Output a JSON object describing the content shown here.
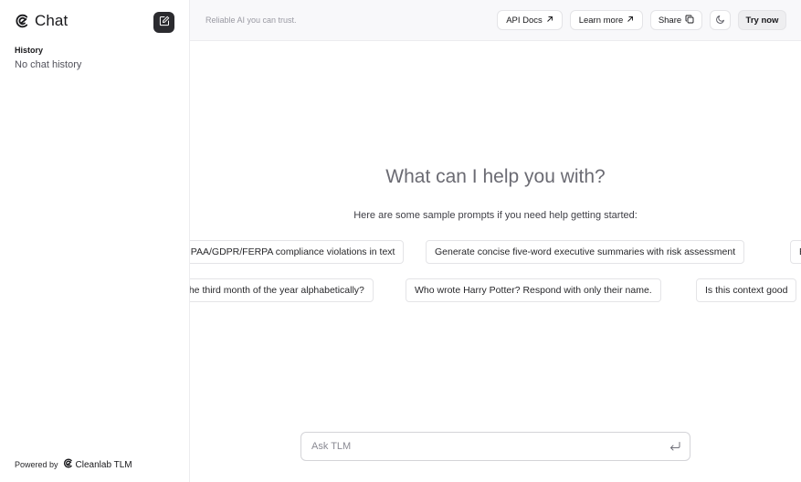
{
  "sidebar": {
    "title": "Chat",
    "history_heading": "History",
    "history_empty": "No chat history",
    "powered_by": "Powered by",
    "powered_brand": "Cleanlab TLM"
  },
  "topbar": {
    "tagline": "Reliable AI you can trust.",
    "api_docs": "API Docs",
    "learn_more": "Learn more",
    "share": "Share",
    "try_now": "Try now"
  },
  "main": {
    "heading": "What can I help you with?",
    "subheading": "Here are some sample prompts if you need help getting started:",
    "prompts_row1": [
      "Detect HIPAA/GDPR/FERPA compliance violations in text",
      "Generate concise five-word executive summaries with risk assessment",
      "E"
    ],
    "prompts_row2": [
      "What is the third month of the year alphabetically?",
      "Who wrote Harry Potter? Respond with only their name.",
      "Is this context good"
    ]
  },
  "composer": {
    "placeholder": "Ask TLM"
  },
  "icons": {
    "logo": "cleanlab-logo-icon",
    "new_chat": "edit-icon",
    "external": "arrow-up-right-icon",
    "share": "copy-icon",
    "theme": "moon-icon",
    "enter": "enter-icon"
  },
  "colors": {
    "topbar_bg": "#f8f8fa",
    "new_chat_bg": "#2b2b2f",
    "border": "#e4e4e7"
  }
}
